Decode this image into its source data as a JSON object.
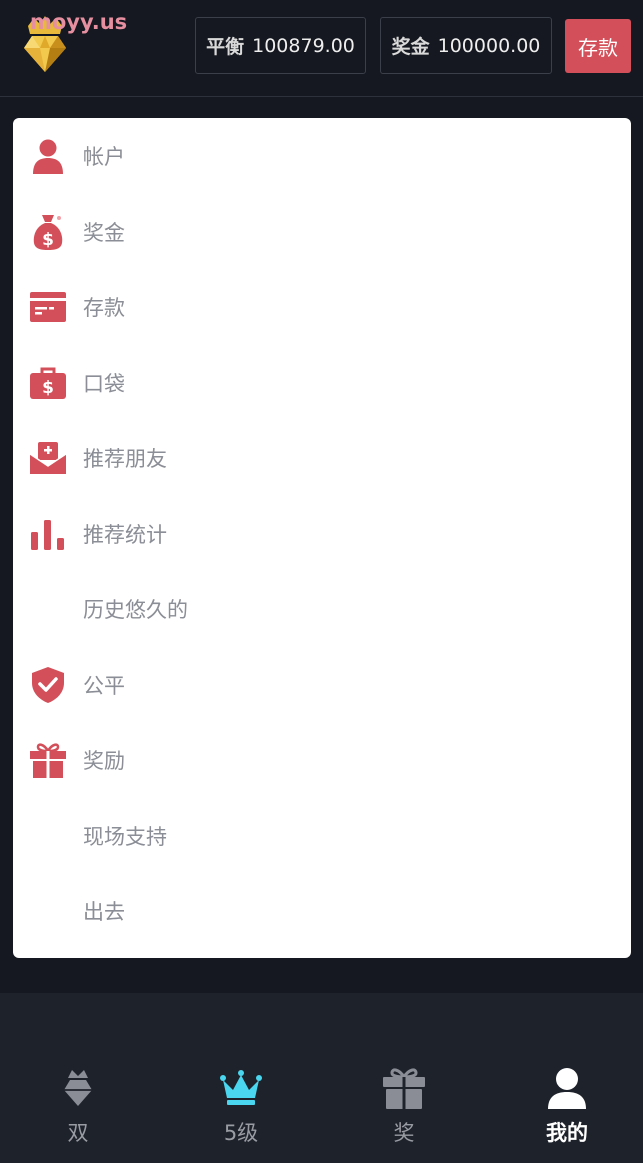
{
  "header": {
    "logo_text": "moyy.us",
    "balance_label": "平衡",
    "balance_value": "100879.00",
    "bonus_label": "奖金",
    "bonus_value": "100000.00",
    "deposit_label": "存款"
  },
  "menu": {
    "accent_color": "#d3505a",
    "items": [
      {
        "label": "帐户",
        "icon": "user-icon"
      },
      {
        "label": "奖金",
        "icon": "money-bag-icon"
      },
      {
        "label": "存款",
        "icon": "card-icon"
      },
      {
        "label": "口袋",
        "icon": "wallet-icon"
      },
      {
        "label": "推荐朋友",
        "icon": "mail-icon"
      },
      {
        "label": "推荐统计",
        "icon": "bar-chart-icon"
      },
      {
        "label": "历史悠久的",
        "icon": ""
      },
      {
        "label": "公平",
        "icon": "shield-check-icon"
      },
      {
        "label": "奖励",
        "icon": "gift-icon"
      },
      {
        "label": "现场支持",
        "icon": ""
      },
      {
        "label": "出去",
        "icon": ""
      }
    ]
  },
  "bottom_nav": {
    "items": [
      {
        "label": "双",
        "icon": "diamond-crown-icon",
        "active": false
      },
      {
        "label": "5级",
        "icon": "crown-icon",
        "active": false
      },
      {
        "label": "奖",
        "icon": "gift-icon",
        "active": false
      },
      {
        "label": "我的",
        "icon": "user-icon",
        "active": true
      }
    ]
  }
}
